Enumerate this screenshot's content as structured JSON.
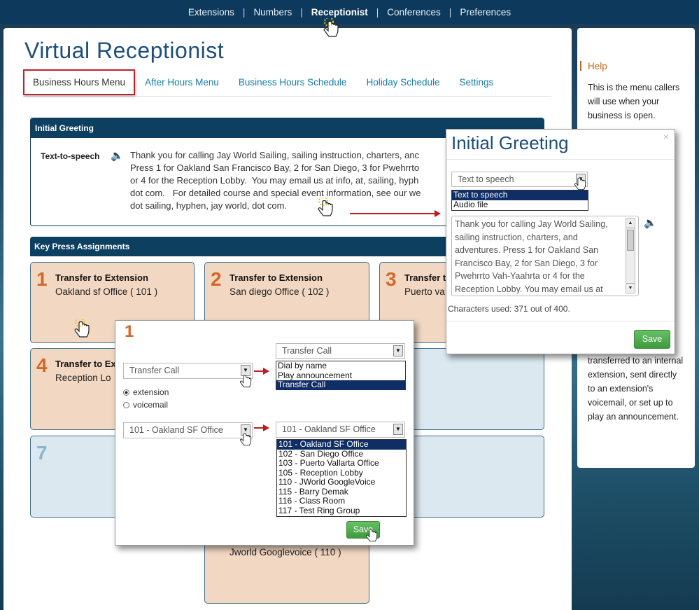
{
  "topnav": {
    "items": [
      "Extensions",
      "Numbers",
      "Receptionist",
      "Conferences",
      "Preferences"
    ],
    "active": "Receptionist",
    "separator": "|"
  },
  "page": {
    "title": "Virtual Receptionist"
  },
  "tabs": [
    "Business Hours Menu",
    "After Hours Menu",
    "Business Hours Schedule",
    "Holiday Schedule",
    "Settings"
  ],
  "greeting": {
    "header": "Initial Greeting",
    "label": "Text-to-speech",
    "text": "Thank you for calling Jay World Sailing, sailing instruction, charters, anc\nPress 1 for Oakland San Francisco Bay, 2 for San Diego, 3 for Pwehrrto\nor 4 for the Reception Lobby.  You may email us at info, at, sailing, hyph\ndot com.   For detailed course and special event information, see our we\ndot sailing, hyphen, jay world, dot com."
  },
  "keypress": {
    "header": "Key Press Assignments",
    "cards": [
      {
        "num": "1",
        "title": "Transfer to Extension",
        "sub": "Oakland sf Office ( 101 )"
      },
      {
        "num": "2",
        "title": "Transfer to Extension",
        "sub": "San diego Office ( 102 )"
      },
      {
        "num": "3",
        "title": "Transfer t",
        "sub": "Puerto va"
      },
      {
        "num": "4",
        "title": "Transfer to Ex",
        "sub": "Reception Lo"
      },
      {
        "num": "7",
        "title": "",
        "sub": ""
      },
      {
        "num": "",
        "title": "",
        "sub": "Jworld Googlevoice ( 110 )"
      }
    ]
  },
  "help": {
    "title": "Help",
    "lines_top": "This is the menu callers will use when your business is open.",
    "lines_bottom": "transferred to an internal extension, sent directly to an extension's voicemail, or set up to play an announcement."
  },
  "greeting_modal": {
    "title": "Initial Greeting",
    "close": "×",
    "select_value": "Text to speech",
    "options": [
      "Text to speech",
      "Audio file"
    ],
    "textarea": "Thank you for calling Jay World Sailing, sailing instruction, charters, and adventures.  Press 1 for Oakland San Francisco Bay, 2 for San Diego, 3 for Pwehrrto Vah-Yaahrta or 4 for the Reception Lobby.  You may email us at",
    "chars_used": "Characters used: 371 out of 400.",
    "save": "Save"
  },
  "key_modal": {
    "num": "1",
    "action_value": "Transfer Call",
    "action_options": [
      "Dial by name",
      "Play announcement",
      "Transfer Call"
    ],
    "radio": [
      "extension",
      "voicemail"
    ],
    "ext_value": "101 - Oakland SF Office",
    "ext_options": [
      "101 - Oakland SF Office",
      "102 - San Diego Office",
      "103 - Puerto Vallarta Office",
      "105 - Reception Lobby",
      "110 - JWorld GoogleVoice",
      "115 -  Barry Demak",
      "116 - Class Room",
      "117 - Test Ring Group"
    ],
    "save": "Save"
  }
}
